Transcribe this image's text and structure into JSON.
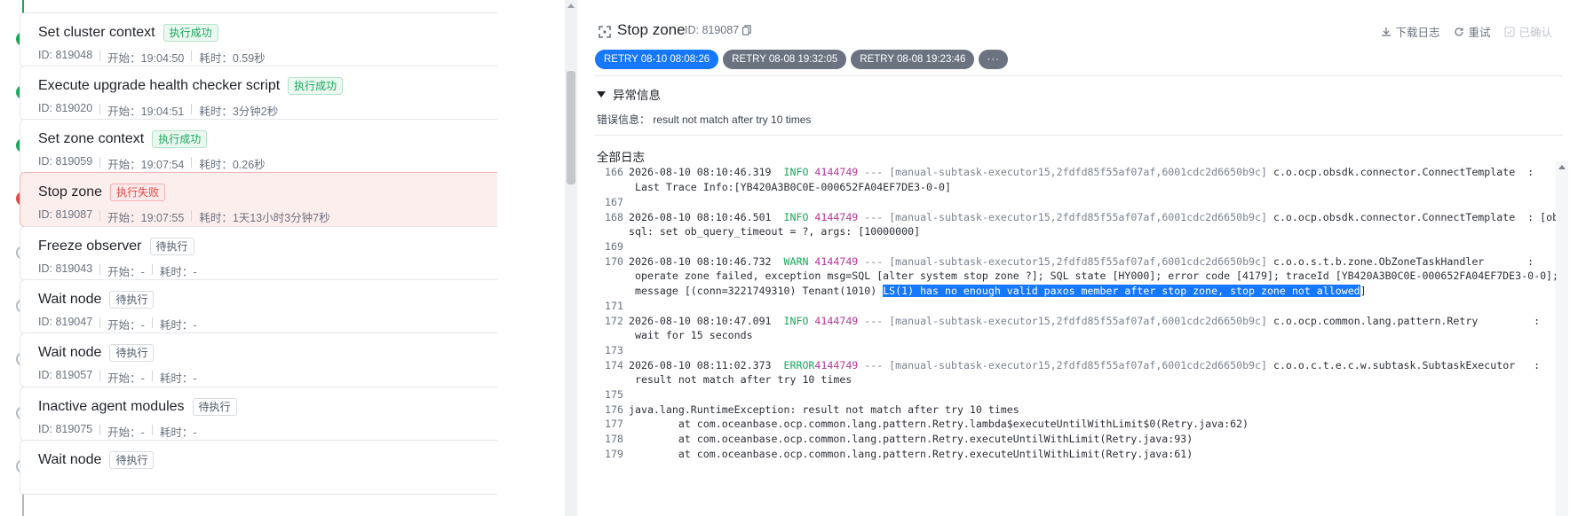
{
  "tasks": [
    {
      "title": "Set cluster context",
      "status": "执行成功",
      "status_kind": "success",
      "id": "ID: 819048",
      "start": "开始：19:04:50",
      "duration": "耗时：0.59秒"
    },
    {
      "title": "Execute upgrade health checker script",
      "status": "执行成功",
      "status_kind": "success",
      "id": "ID: 819020",
      "start": "开始：19:04:51",
      "duration": "耗时：3分钟2秒"
    },
    {
      "title": "Set zone context",
      "status": "执行成功",
      "status_kind": "success",
      "id": "ID: 819059",
      "start": "开始：19:07:54",
      "duration": "耗时：0.26秒"
    },
    {
      "title": "Stop zone",
      "status": "执行失败",
      "status_kind": "fail",
      "id": "ID: 819087",
      "start": "开始：19:07:55",
      "duration": "耗时：1天13小时3分钟7秒"
    },
    {
      "title": "Freeze observer",
      "status": "待执行",
      "status_kind": "pending",
      "id": "ID: 819043",
      "start": "开始：-",
      "duration": "耗时：-"
    },
    {
      "title": "Wait node",
      "status": "待执行",
      "status_kind": "pending",
      "id": "ID: 819047",
      "start": "开始：-",
      "duration": "耗时：-"
    },
    {
      "title": "Wait node",
      "status": "待执行",
      "status_kind": "pending",
      "id": "ID: 819057",
      "start": "开始：-",
      "duration": "耗时：-"
    },
    {
      "title": "Inactive agent modules",
      "status": "待执行",
      "status_kind": "pending",
      "id": "ID: 819075",
      "start": "开始：-",
      "duration": "耗时：-"
    },
    {
      "title": "Wait node",
      "status": "待执行",
      "status_kind": "pending",
      "id": "",
      "start": "",
      "duration": ""
    }
  ],
  "detail": {
    "title": "Stop zone",
    "id": "ID: 819087",
    "actions": {
      "download": "下载日志",
      "retry": "重试",
      "skip": "已确认"
    },
    "retries": [
      "RETRY 08-10 08:08:26",
      "RETRY 08-08 19:32:05",
      "RETRY 08-08 19:23:46",
      "···"
    ],
    "exception_header": "异常信息",
    "error_message": "错误信息： result not match after try 10 times",
    "all_logs_header": "全部日志"
  },
  "logs": [
    {
      "n": "166",
      "ts": "2026-08-10 08:10:46.319",
      "lvl": "INFO",
      "pid": "4144749",
      "thr": "--- [manual-subtask-executor15,2fdfd85f55af07af,6001cdc2d6650b9c]",
      "cls": "c.o.ocp.obsdk.connector.ConnectTemplate  :"
    },
    {
      "cont": " Last Trace Info:[YB420A3B0C0E-000652FA04EF7DE3-0-0]"
    },
    {
      "n": "167"
    },
    {
      "n": "168",
      "ts": "2026-08-10 08:10:46.501",
      "lvl": "INFO",
      "pid": "4144749",
      "thr": "--- [manual-subtask-executor15,2fdfd85f55af07af,6001cdc2d6650b9c]",
      "cls": "c.o.ocp.obsdk.connector.ConnectTemplate  : [obsdk]"
    },
    {
      "cont": "sql: set ob_query_timeout = ?, args: [10000000]"
    },
    {
      "n": "169"
    },
    {
      "n": "170",
      "ts": "2026-08-10 08:10:46.732",
      "lvl": "WARN",
      "pid": "4144749",
      "thr": "--- [manual-subtask-executor15,2fdfd85f55af07af,6001cdc2d6650b9c]",
      "cls": "c.o.o.s.t.b.zone.ObZoneTaskHandler       :"
    },
    {
      "cont": " operate zone failed, exception msg=SQL [alter system stop zone ?]; SQL state [HY000]; error code [4179]; traceId [YB420A3B0C0E-000652FA04EF7DE3-0-0];"
    },
    {
      "cont": " message [(conn=3221749310) Tenant(1010) ",
      "hl": "LS(1) has no enough valid paxos member after stop zone, stop zone not allowed",
      "tail": "]"
    },
    {
      "n": "171"
    },
    {
      "n": "172",
      "ts": "2026-08-10 08:10:47.091",
      "lvl": "INFO",
      "pid": "4144749",
      "thr": "--- [manual-subtask-executor15,2fdfd85f55af07af,6001cdc2d6650b9c]",
      "cls": "c.o.ocp.common.lang.pattern.Retry         :"
    },
    {
      "cont": " wait for 15 seconds"
    },
    {
      "n": "173"
    },
    {
      "n": "174",
      "ts": "2026-08-10 08:11:02.373",
      "lvl": "ERROR",
      "pid": "4144749",
      "thr": "--- [manual-subtask-executor15,2fdfd85f55af07af,6001cdc2d6650b9c]",
      "cls": "c.o.o.c.t.e.c.w.subtask.SubtaskExecutor   :"
    },
    {
      "cont": " result not match after try 10 times"
    },
    {
      "n": "175"
    },
    {
      "n": "176",
      "plain": "java.lang.RuntimeException: result not match after try 10 times"
    },
    {
      "n": "177",
      "plain": "        at com.oceanbase.ocp.common.lang.pattern.Retry.lambda$executeUntilWithLimit$0(Retry.java:62)"
    },
    {
      "n": "178",
      "plain": "        at com.oceanbase.ocp.common.lang.pattern.Retry.executeUntilWithLimit(Retry.java:93)"
    },
    {
      "n": "179",
      "plain": "        at com.oceanbase.ocp.common.lang.pattern.Retry.executeUntilWithLimit(Retry.java:61)"
    }
  ],
  "colors": {
    "success": "#1aa85c",
    "fail": "#e54848",
    "accent": "#1677ff",
    "pid": "#b8369a"
  }
}
